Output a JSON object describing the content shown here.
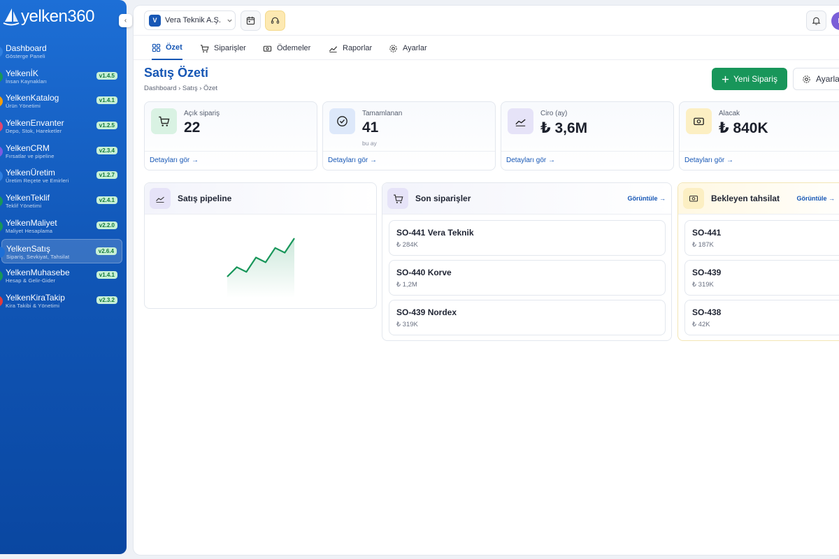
{
  "brand": {
    "name": "yelken360"
  },
  "sidebar": {
    "items": [
      {
        "title": "Dashboard",
        "subtitle": "Gösterge Paneli",
        "version": "",
        "color": "#2f7fe0"
      },
      {
        "title": "YelkenİK",
        "subtitle": "İnsan Kaynakları",
        "version": "v1.4.5",
        "color": "#18965a"
      },
      {
        "title": "YelkenKatalog",
        "subtitle": "Ürün Yönetimi",
        "version": "v1.4.1",
        "color": "#f59e0b"
      },
      {
        "title": "YelkenEnvanter",
        "subtitle": "Depo, Stok, Hareketler",
        "version": "v1.2.5",
        "color": "#e2466d"
      },
      {
        "title": "YelkenCRM",
        "subtitle": "Fırsatlar ve pipeline",
        "version": "v2.3.4",
        "color": "#7c5be0"
      },
      {
        "title": "YelkenÜretim",
        "subtitle": "Üretim Reçete ve Emirleri",
        "version": "v1.2.7",
        "color": "#2f7fe0"
      },
      {
        "title": "YelkenTeklif",
        "subtitle": "Teklif Yönetimi",
        "version": "v2.4.1",
        "color": "#18965a"
      },
      {
        "title": "YelkenMaliyet",
        "subtitle": "Maliyet Hesaplama",
        "version": "v2.2.0",
        "color": "#18965a"
      },
      {
        "title": "YelkenSatış",
        "subtitle": "Sipariş, Sevkiyat, Tahsilat",
        "version": "v2.6.4",
        "color": "#1d6fd6",
        "active": true
      },
      {
        "title": "YelkenMuhasebe",
        "subtitle": "Hesap & Gelir-Gider",
        "version": "v1.4.1",
        "color": "#18965a"
      },
      {
        "title": "YelkenKiraTakip",
        "subtitle": "Kira Takibi & Yönetimi",
        "version": "v2.3.2",
        "color": "#e23b3b"
      }
    ]
  },
  "topbar": {
    "company_initial": "V",
    "company_name": "Vera Teknik A.Ş.",
    "avatar_initial": "D"
  },
  "tabs": [
    {
      "label": "Özet",
      "icon": "grid-icon",
      "active": true
    },
    {
      "label": "Siparişler",
      "icon": "cart-icon"
    },
    {
      "label": "Ödemeler",
      "icon": "cash-icon"
    },
    {
      "label": "Raporlar",
      "icon": "chart-line-icon"
    },
    {
      "label": "Ayarlar",
      "icon": "gear-icon"
    }
  ],
  "page": {
    "title": "Satış Özeti",
    "breadcrumb": "Dashboard › Satış › Özet",
    "new_order_label": "Yeni Sipariş",
    "settings_label": "Ayarlar"
  },
  "kpis": [
    {
      "label": "Açık sipariş",
      "value": "22",
      "sub": "",
      "link": "Detayları gör →",
      "icon_bg": "#d9f2e3"
    },
    {
      "label": "Tamamlanan",
      "value": "41",
      "sub": "bu ay",
      "link": "Detayları gör →",
      "icon_bg": "#dde8fa"
    },
    {
      "label": "Ciro (ay)",
      "value": "₺ 3,6M",
      "sub": "",
      "link": "Detayları gör →",
      "icon_bg": "#e6e3f8"
    },
    {
      "label": "Alacak",
      "value": "₺ 840K",
      "sub": "",
      "link": "Detayları gör →",
      "icon_bg": "#fcefc3"
    }
  ],
  "pipeline": {
    "title": "Satış pipeline",
    "points": [
      12,
      18,
      15,
      24,
      21,
      30,
      27,
      36
    ]
  },
  "recent_orders": {
    "title": "Son siparişler",
    "link": "Görüntüle →",
    "items": [
      {
        "title": "SO-441 Vera Teknik",
        "amount": "₺ 284K"
      },
      {
        "title": "SO-440 Korve",
        "amount": "₺ 1,2M"
      },
      {
        "title": "SO-439 Nordex",
        "amount": "₺ 319K"
      }
    ]
  },
  "pending": {
    "title": "Bekleyen tahsilat",
    "link": "Görüntüle →",
    "items": [
      {
        "title": "SO-441",
        "amount": "₺ 187K"
      },
      {
        "title": "SO-439",
        "amount": "₺ 319K"
      },
      {
        "title": "SO-438",
        "amount": "₺ 42K"
      }
    ]
  }
}
